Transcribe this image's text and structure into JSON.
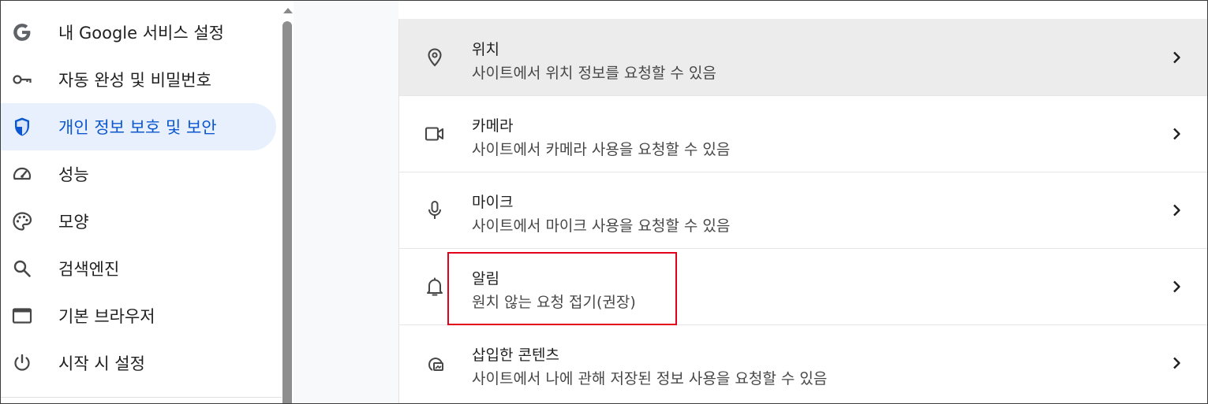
{
  "sidebar": {
    "items": [
      {
        "label": "내 Google 서비스 설정",
        "icon": "google-g-icon"
      },
      {
        "label": "자동 완성 및 비밀번호",
        "icon": "key-icon"
      },
      {
        "label": "개인 정보 보호 및 보안",
        "icon": "shield-icon",
        "active": true
      },
      {
        "label": "성능",
        "icon": "speedometer-icon"
      },
      {
        "label": "모양",
        "icon": "palette-icon"
      },
      {
        "label": "검색엔진",
        "icon": "search-icon"
      },
      {
        "label": "기본 브라우저",
        "icon": "browser-window-icon"
      },
      {
        "label": "시작 시 설정",
        "icon": "power-icon"
      }
    ]
  },
  "permissions": {
    "rows": [
      {
        "title": "위치",
        "subtitle": "사이트에서 위치 정보를 요청할 수 있음",
        "icon": "location-pin-icon"
      },
      {
        "title": "카메라",
        "subtitle": "사이트에서 카메라 사용을 요청할 수 있음",
        "icon": "camera-icon"
      },
      {
        "title": "마이크",
        "subtitle": "사이트에서 마이크 사용을 요청할 수 있음",
        "icon": "microphone-icon"
      },
      {
        "title": "알림",
        "subtitle": "원치 않는 요청 접기(권장)",
        "icon": "bell-icon"
      },
      {
        "title": "삽입한 콘텐츠",
        "subtitle": "사이트에서 나에 관해 저장된 정보 사용을 요청할 수 있음",
        "icon": "embedded-content-icon"
      }
    ]
  },
  "colors": {
    "accent": "#0b57d0",
    "active_bg": "#e8f0fe",
    "hover_row": "#ececec",
    "highlight_border": "#e2001a"
  }
}
